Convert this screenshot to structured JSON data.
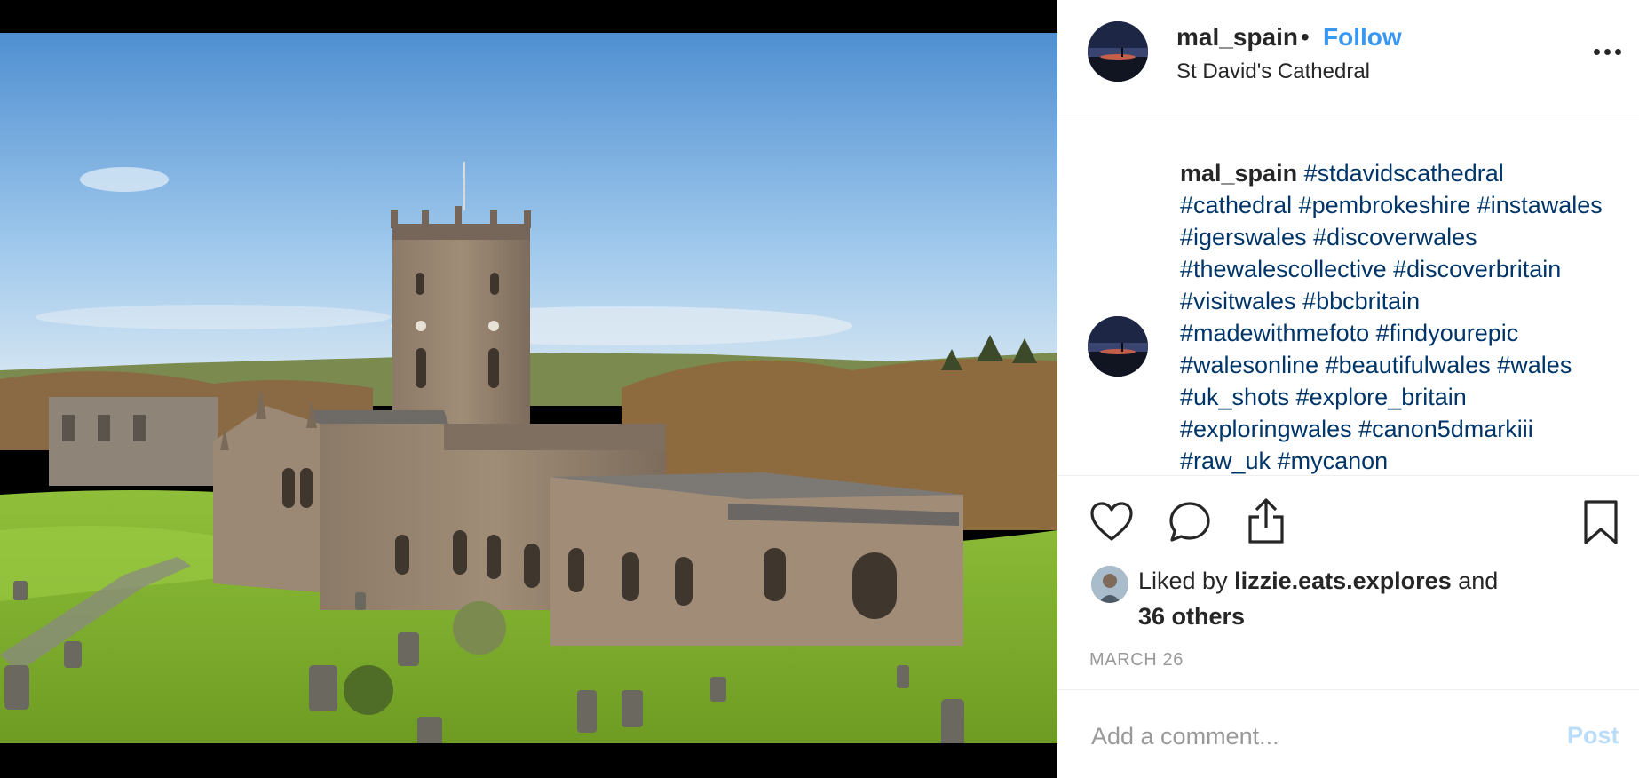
{
  "post": {
    "username": "mal_spain",
    "separator": "•",
    "follow_label": "Follow",
    "location": "St David's Cathedral",
    "more_icon": "more-options-icon"
  },
  "caption": {
    "username": "mal_spain",
    "hashtags": [
      "#stdavidscathedral",
      "#cathedral",
      "#pembrokeshire",
      "#instawales",
      "#igerswales",
      "#discoverwales",
      "#thewalescollective",
      "#discoverbritain",
      "#visitwales",
      "#bbcbritain",
      "#madewithmefoto",
      "#findyourepic",
      "#walesonline",
      "#beautifulwales",
      "#wales",
      "#uk_shots",
      "#explore_britain",
      "#exploringwales",
      "#canon5dmarkiii",
      "#raw_uk",
      "#mycanon"
    ]
  },
  "actions": {
    "like_icon": "heart-icon",
    "comment_icon": "speech-bubble-icon",
    "share_icon": "share-icon",
    "save_icon": "bookmark-icon"
  },
  "likes": {
    "prefix": "Liked by",
    "user": "lizzie.eats.explores",
    "conjunction": "and",
    "others": "36 others"
  },
  "date": "MARCH 26",
  "comment_box": {
    "placeholder": "Add a comment...",
    "post_label": "Post"
  },
  "colors": {
    "link": "#3897f0",
    "hashtag": "#003569",
    "muted": "#999999",
    "post_disabled": "#b9dcfb"
  }
}
